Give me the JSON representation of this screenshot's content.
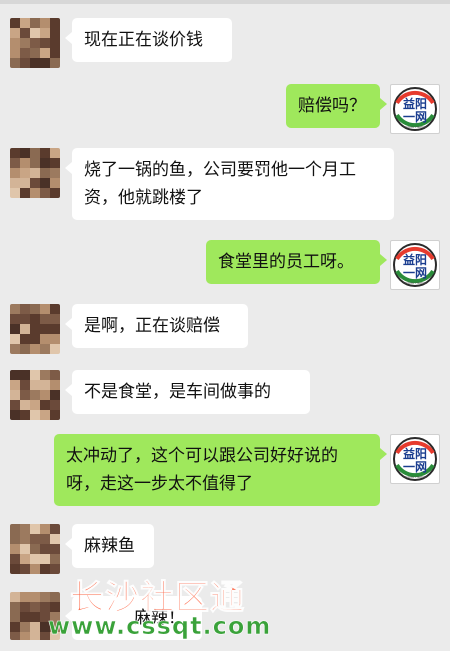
{
  "app": {
    "title": ""
  },
  "colors": {
    "incoming_bubble": "#ffffff",
    "outgoing_bubble": "#9fe85c",
    "background": "#ebebeb",
    "watermark_cn": "#ff5a36",
    "watermark_url": "#3aa23a"
  },
  "outgoing_avatar": {
    "line1": "益阳",
    "line2": "一网",
    "sub": "YIYANG YIWANG"
  },
  "messages": [
    {
      "dir": "in",
      "text": "现在正在谈价钱"
    },
    {
      "dir": "out",
      "text": "赔偿吗？"
    },
    {
      "dir": "in",
      "text": "烧了一锅的鱼，公司要罚他一个月工资，他就跳楼了"
    },
    {
      "dir": "out",
      "text": "食堂里的员工呀。"
    },
    {
      "dir": "in",
      "text": "是啊，正在谈赔偿"
    },
    {
      "dir": "in",
      "text": "不是食堂，是车间做事的"
    },
    {
      "dir": "out",
      "text": "太冲动了，这个可以跟公司好好说的呀，走这一步太不值得了"
    },
    {
      "dir": "in",
      "text": "麻辣鱼"
    },
    {
      "dir": "in",
      "text": "麻辣！"
    }
  ],
  "watermark": {
    "text_cn": "长沙社区通",
    "url": "www.cssqt.com"
  }
}
